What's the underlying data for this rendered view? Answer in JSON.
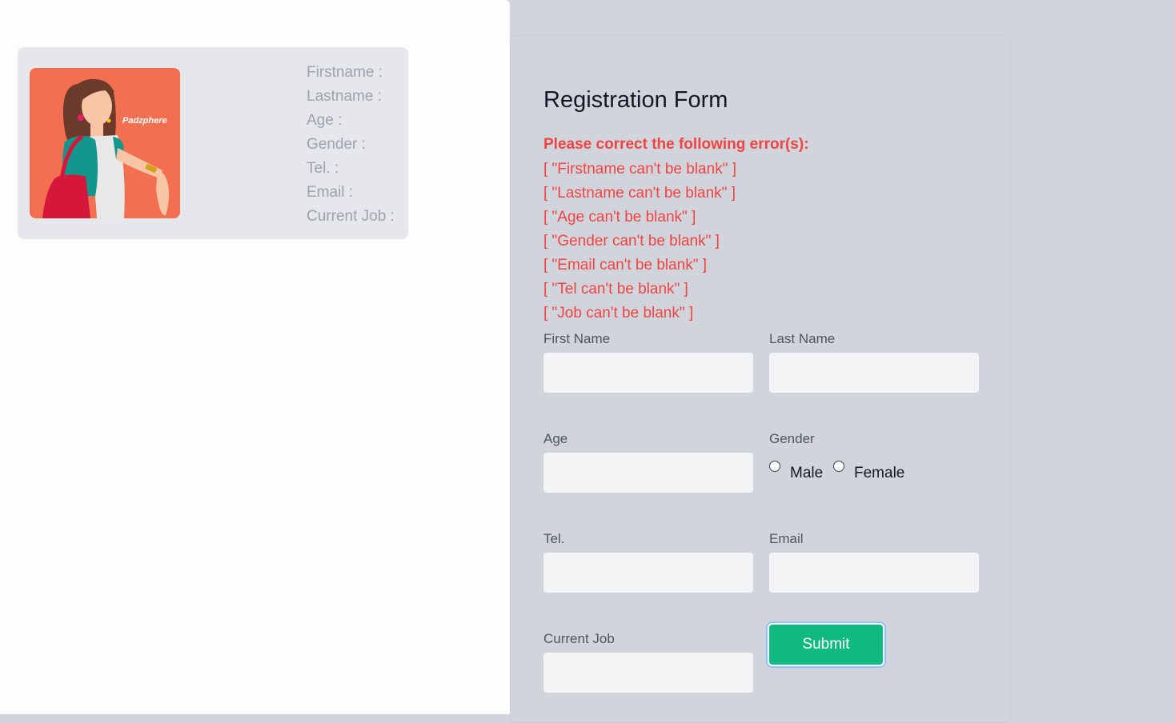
{
  "profile": {
    "avatar_brand": "Padzphere",
    "fields": [
      "Firstname :",
      "Lastname :",
      "Age :",
      "Gender :",
      "Tel. :",
      "Email :",
      "Current Job :"
    ]
  },
  "form": {
    "title": "Registration Form",
    "error_heading": "Please correct the following error(s):",
    "errors": [
      "[ \"Firstname can't be blank\" ]",
      "[ \"Lastname can't be blank\" ]",
      "[ \"Age can't be blank\" ]",
      "[ \"Gender can't be blank\" ]",
      "[ \"Email can't be blank\" ]",
      "[ \"Tel can't be blank\" ]",
      "[ \"Job can't be blank\" ]"
    ],
    "first_name": {
      "label": "First Name",
      "value": ""
    },
    "last_name": {
      "label": "Last Name",
      "value": ""
    },
    "age": {
      "label": "Age",
      "value": ""
    },
    "gender": {
      "label": "Gender",
      "options": [
        "Male",
        "Female"
      ],
      "selected": ""
    },
    "tel": {
      "label": "Tel.",
      "value": ""
    },
    "email": {
      "label": "Email",
      "value": ""
    },
    "current_job": {
      "label": "Current Job",
      "value": ""
    },
    "submit_label": "Submit"
  },
  "colors": {
    "page_bg": "#d1d5db",
    "error": "#ef4444",
    "submit": "#10b981",
    "avatar_bg": "#f26f50"
  }
}
